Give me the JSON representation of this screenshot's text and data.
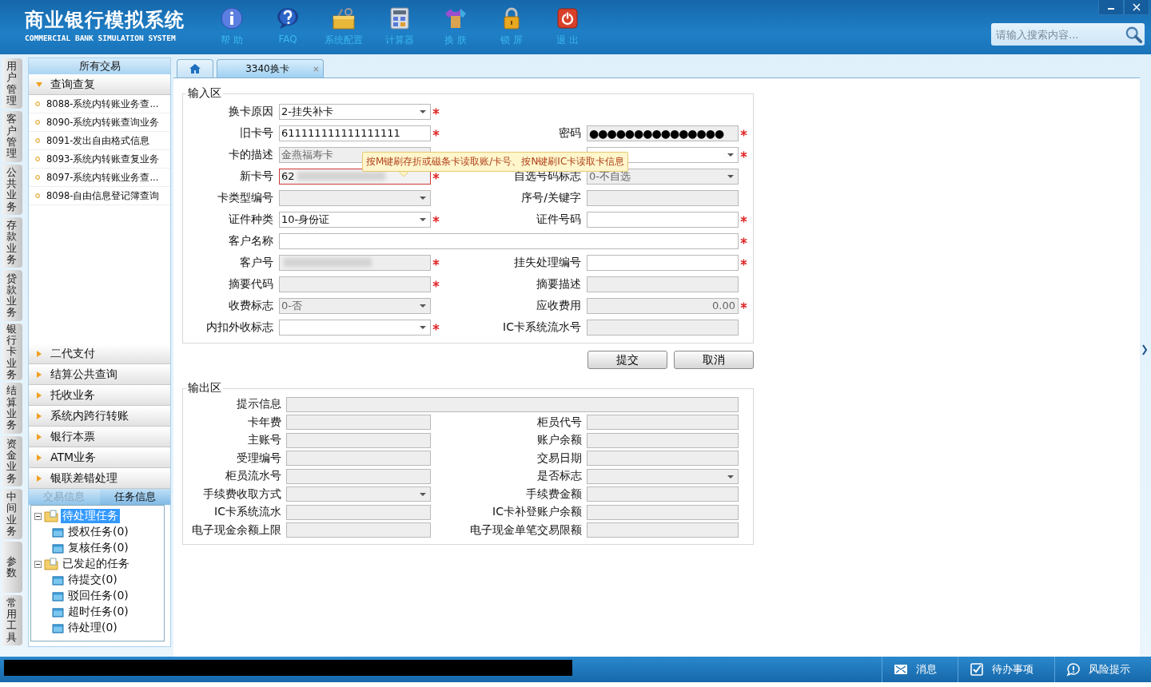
{
  "app": {
    "title": "商业银行模拟系统",
    "subtitle": "COMMERCIAL BANK SIMULATION SYSTEM"
  },
  "toolbar": [
    {
      "label": "帮 助",
      "kind": "help"
    },
    {
      "label": "FAQ",
      "kind": "faq"
    },
    {
      "label": "系统配置",
      "kind": "config"
    },
    {
      "label": "计算器",
      "kind": "calculator"
    },
    {
      "label": "换 肤",
      "kind": "skin"
    },
    {
      "label": "锁 屏",
      "kind": "lock"
    },
    {
      "label": "退 出",
      "kind": "exit"
    }
  ],
  "search": {
    "placeholder": "请输入搜索内容..."
  },
  "side_tabs": [
    {
      "label": "用户管理",
      "selected": false
    },
    {
      "label": "客户管理",
      "selected": false
    },
    {
      "label": "公共业务",
      "selected": false
    },
    {
      "label": "存款业务",
      "selected": false
    },
    {
      "label": "贷款业务",
      "selected": false
    },
    {
      "label": "银行卡业务",
      "selected": false
    },
    {
      "label": "结算业务",
      "selected": false
    },
    {
      "label": "资金业务",
      "selected": false
    },
    {
      "label": "中间业务",
      "selected": false
    },
    {
      "label": "参数",
      "selected": false
    },
    {
      "label": "常用工具",
      "selected": false
    }
  ],
  "sidebar": {
    "title": "所有交易",
    "groups": [
      {
        "label": "查询查复",
        "expanded": true,
        "items": [
          "8088-系统内转账业务查...",
          "8090-系统内转账查询业务",
          "8091-发出自由格式信息",
          "8093-系统内转账查复业务",
          "8097-系统内转账业务查...",
          "8098-自由信息登记簿查询"
        ]
      },
      {
        "label": "二代支付",
        "expanded": false
      },
      {
        "label": "结算公共查询",
        "expanded": false
      },
      {
        "label": "托收业务",
        "expanded": false
      },
      {
        "label": "系统内跨行转账",
        "expanded": false
      },
      {
        "label": "银行本票",
        "expanded": false
      },
      {
        "label": "ATM业务",
        "expanded": false
      },
      {
        "label": "银联差错处理",
        "expanded": false
      }
    ],
    "info_tabs": [
      {
        "label": "交易信息",
        "selected": false
      },
      {
        "label": "任务信息",
        "selected": true
      }
    ],
    "tree": [
      {
        "label": "待处理任务",
        "selected": true,
        "expanded": true,
        "children": [
          {
            "label": "授权任务(0)",
            "selected": false
          },
          {
            "label": "复核任务(0)",
            "selected": false
          }
        ]
      },
      {
        "label": "已发起的任务",
        "selected": false,
        "expanded": true,
        "children": [
          {
            "label": "待提交(0)",
            "selected": false
          },
          {
            "label": "驳回任务(0)",
            "selected": false
          },
          {
            "label": "超时任务(0)",
            "selected": false
          },
          {
            "label": "待处理(0)",
            "selected": false
          }
        ]
      }
    ]
  },
  "tabs": [
    {
      "kind": "home",
      "selected": false
    },
    {
      "kind": "page",
      "label": "3340换卡",
      "selected": true
    }
  ],
  "input_area": {
    "title": "输入区",
    "rows": [
      [
        {
          "label": "换卡原因",
          "kind": "select",
          "value": "2-挂失补卡",
          "required": true,
          "disabled": false
        }
      ],
      [
        {
          "label": "旧卡号",
          "kind": "text",
          "value": "611111111111111111",
          "required": true,
          "disabled": false
        },
        {
          "label": "密码",
          "kind": "password",
          "value": "●●●●●●●●●●●●●●●",
          "required": true,
          "disabled": true
        }
      ],
      [
        {
          "label": "卡的描述",
          "kind": "text",
          "value": "金燕福寿卡",
          "required": false,
          "disabled": true
        },
        {
          "kind": "select",
          "required": true,
          "disabled": false
        }
      ],
      [
        {
          "label": "新卡号",
          "kind": "text",
          "value": "62",
          "blurred": true,
          "invalid": true,
          "required": true,
          "disabled": false
        },
        {
          "label": "自选号码标志",
          "kind": "select",
          "value": "0-不自选",
          "required": false,
          "disabled": true
        }
      ],
      [
        {
          "label": "卡类型编号",
          "kind": "select",
          "required": false,
          "disabled": true
        },
        {
          "label": "序号/关键字",
          "kind": "text",
          "required": false,
          "disabled": true
        }
      ],
      [
        {
          "label": "证件种类",
          "kind": "select",
          "value": "10-身份证",
          "required": true,
          "disabled": false
        },
        {
          "label": "证件号码",
          "kind": "text",
          "required": true,
          "disabled": false
        }
      ],
      [
        {
          "label": "客户名称",
          "kind": "text",
          "wide": true,
          "required": true,
          "disabled": false
        }
      ],
      [
        {
          "label": "客户号",
          "kind": "text",
          "blurred": true,
          "required": true,
          "disabled": true
        },
        {
          "label": "挂失处理编号",
          "kind": "text",
          "required": true,
          "disabled": false
        }
      ],
      [
        {
          "label": "摘要代码",
          "kind": "text",
          "required": true,
          "disabled": true
        },
        {
          "label": "摘要描述",
          "kind": "text",
          "required": false,
          "disabled": true
        }
      ],
      [
        {
          "label": "收费标志",
          "kind": "select",
          "value": "0-否",
          "required": false,
          "disabled": true
        },
        {
          "label": "应收费用",
          "kind": "amount",
          "value": "0.00",
          "required": true,
          "disabled": true
        }
      ],
      [
        {
          "label": "内扣外收标志",
          "kind": "select",
          "required": true,
          "disabled": false
        },
        {
          "label": "IC卡系统流水号",
          "kind": "text",
          "required": false,
          "disabled": true
        }
      ]
    ]
  },
  "tooltip": "按M键刷存折或磁条卡读取账/卡号、按N键刷IC卡读取卡信息",
  "buttons": [
    "提交",
    "取消"
  ],
  "output_area": {
    "title": "输出区",
    "rows": [
      [
        {
          "label": "提示信息",
          "kind": "text",
          "wide": true,
          "disabled": true
        }
      ],
      [
        {
          "label": "卡年费",
          "kind": "text",
          "disabled": true
        },
        {
          "label": "柜员代号",
          "kind": "text",
          "disabled": true
        }
      ],
      [
        {
          "label": "主账号",
          "kind": "text",
          "disabled": true
        },
        {
          "label": "账户余额",
          "kind": "text",
          "disabled": true
        }
      ],
      [
        {
          "label": "受理编号",
          "kind": "text",
          "disabled": true
        },
        {
          "label": "交易日期",
          "kind": "text",
          "disabled": true
        }
      ],
      [
        {
          "label": "柜员流水号",
          "kind": "text",
          "disabled": true
        },
        {
          "label": "是否标志",
          "kind": "select",
          "disabled": true
        }
      ],
      [
        {
          "label": "手续费收取方式",
          "kind": "select",
          "disabled": true
        },
        {
          "label": "手续费金额",
          "kind": "text",
          "disabled": true
        }
      ],
      [
        {
          "label": "IC卡系统流水",
          "kind": "text",
          "disabled": true
        },
        {
          "label": "IC卡补登账户余额",
          "kind": "text",
          "disabled": true
        }
      ],
      [
        {
          "label": "电子现金余额上限",
          "kind": "text",
          "disabled": true
        },
        {
          "label": "电子现金单笔交易限额",
          "kind": "text",
          "disabled": true
        }
      ]
    ]
  },
  "status_bar": {
    "items": [
      {
        "label": "消息",
        "kind": "message"
      },
      {
        "label": "待办事项",
        "kind": "todo"
      },
      {
        "label": "风险提示",
        "kind": "risk"
      }
    ]
  }
}
